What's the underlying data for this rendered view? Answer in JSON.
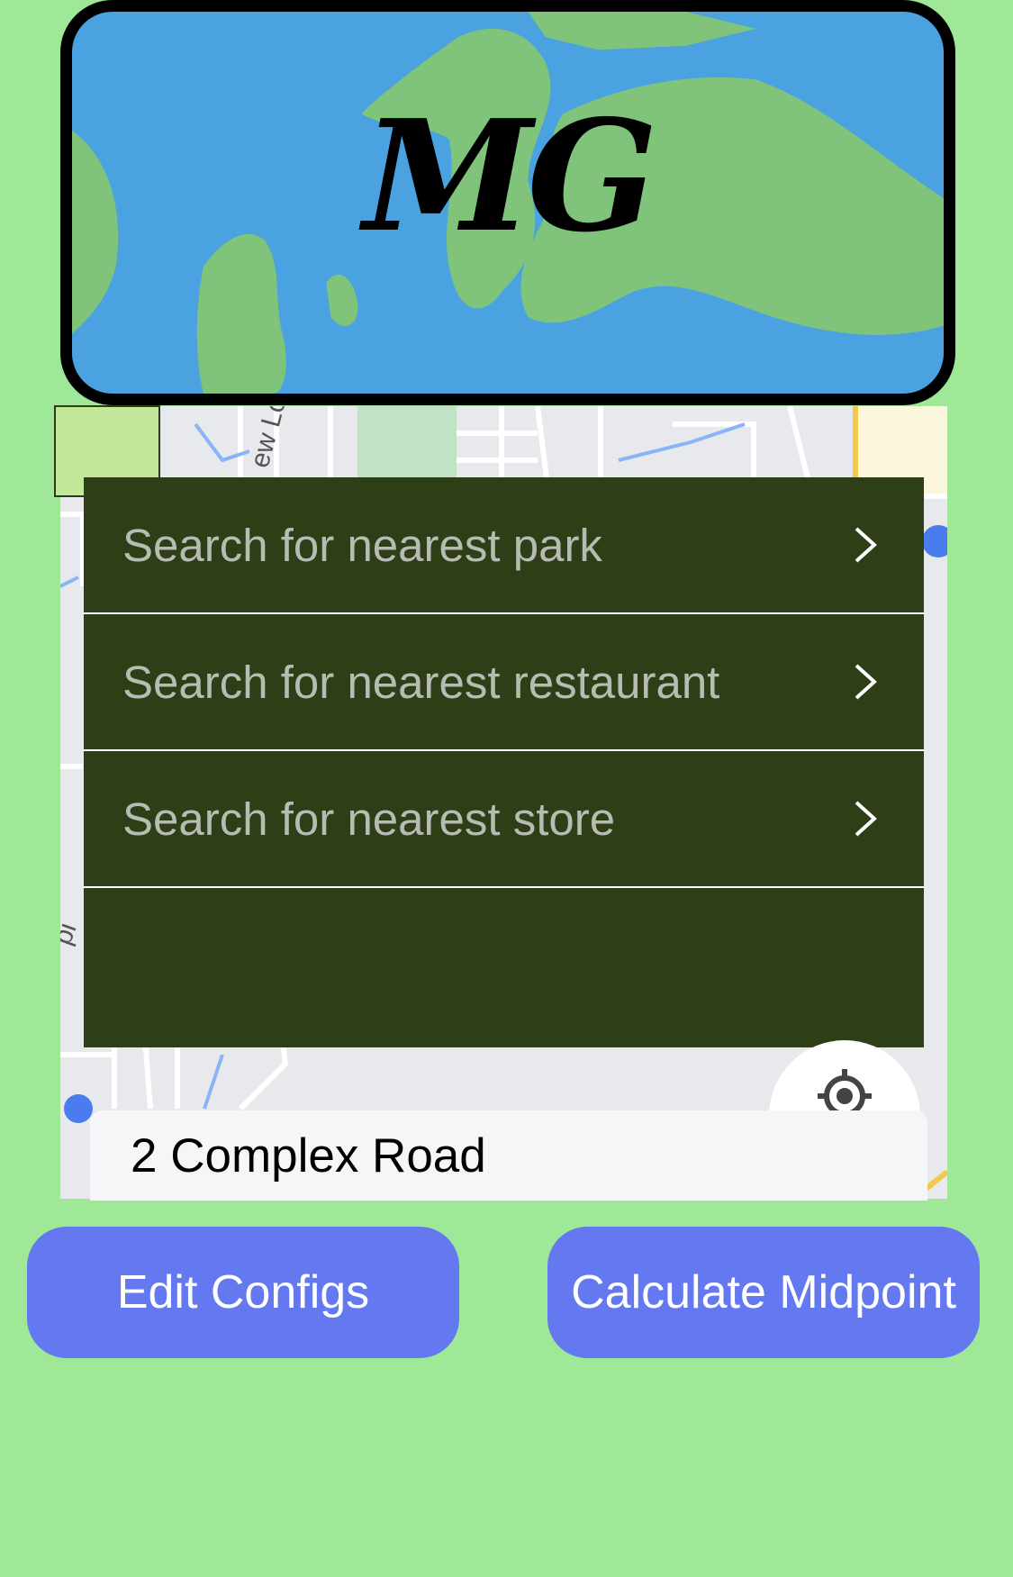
{
  "logo": {
    "text": "MG"
  },
  "search_options": [
    {
      "label": "Search for nearest park"
    },
    {
      "label": "Search for nearest restaurant"
    },
    {
      "label": "Search for nearest store"
    }
  ],
  "map": {
    "street_label": "ew Lo",
    "side_label": "pi"
  },
  "address_field": {
    "value": "2 Complex Road"
  },
  "buttons": {
    "edit": "Edit Configs",
    "calculate": "Calculate Midpoint"
  },
  "colors": {
    "background": "#9ee898",
    "results_panel": "#2e3e16",
    "button": "#6479f0",
    "logo_water": "#4aa3e0",
    "logo_land": "#7fc47a"
  }
}
